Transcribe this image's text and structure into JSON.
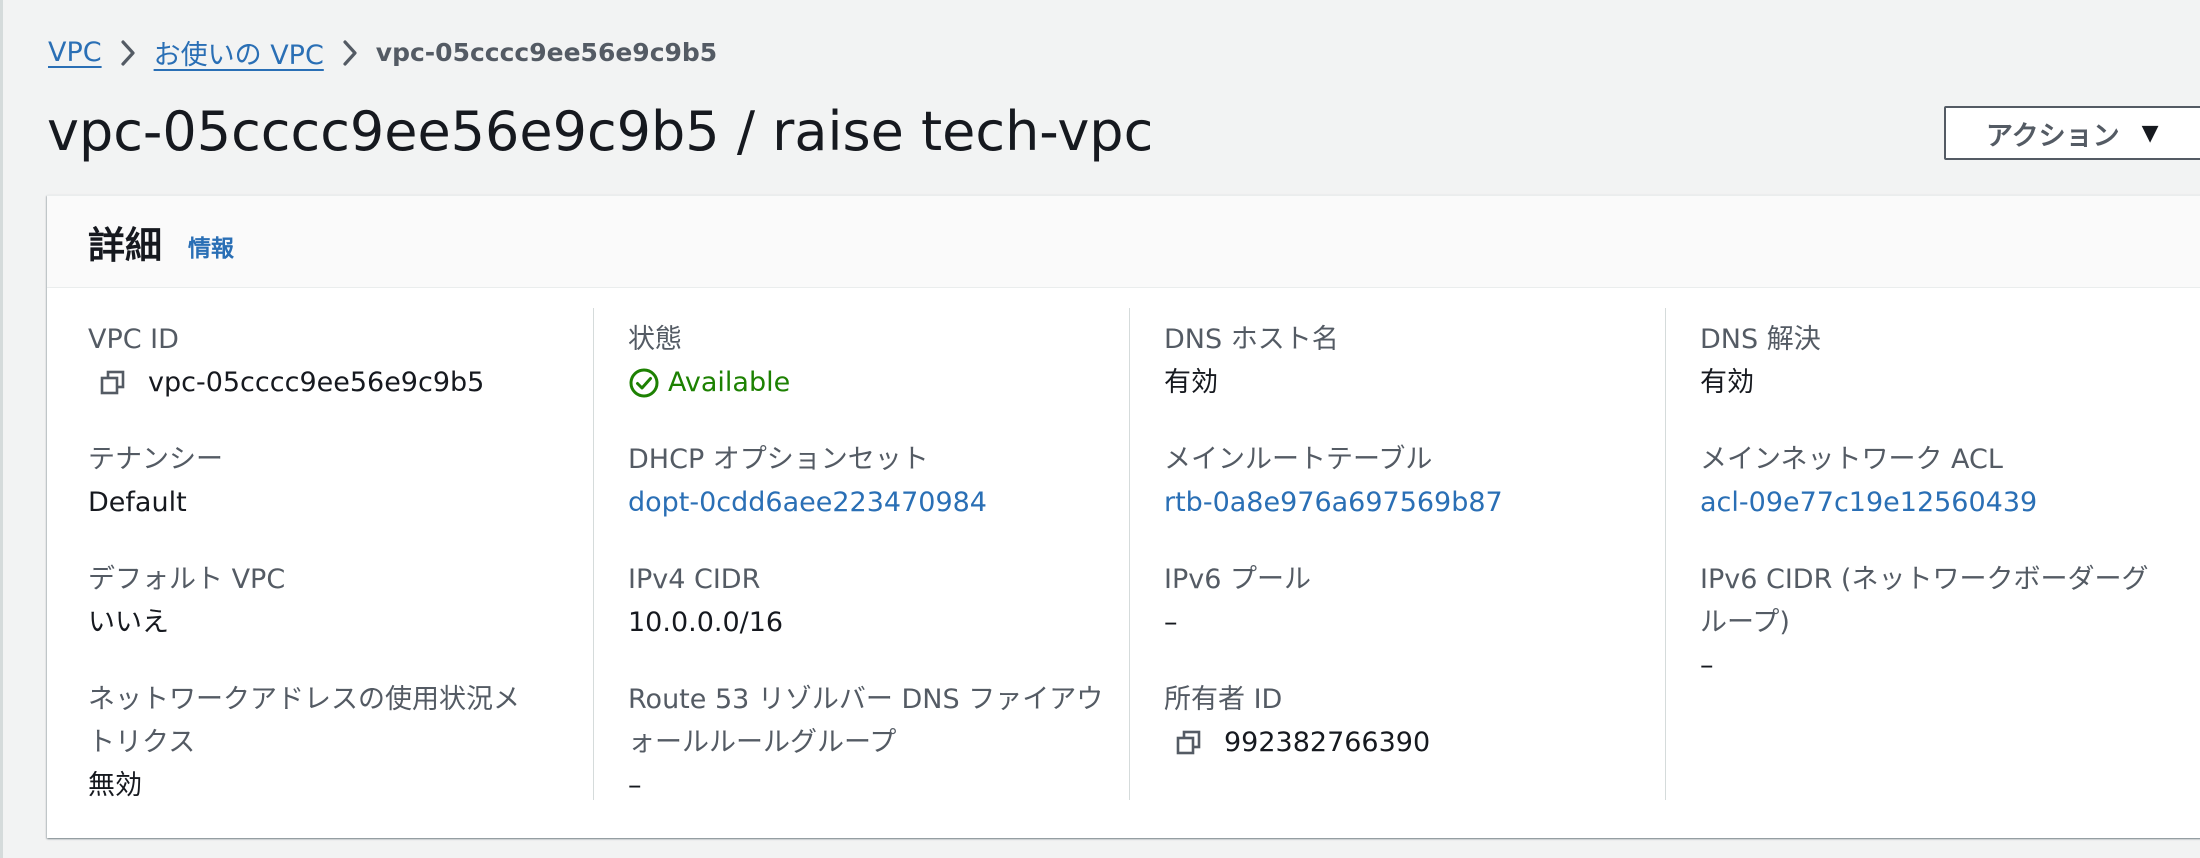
{
  "breadcrumb": {
    "items": [
      {
        "label": "VPC"
      },
      {
        "label": "お使いの VPC"
      }
    ],
    "current": "vpc-05cccc9ee56e9c9b5"
  },
  "page": {
    "title": "vpc-05cccc9ee56e9c9b5 / raise tech-vpc",
    "actions_label": "アクション"
  },
  "details": {
    "title": "詳細",
    "info_label": "情報",
    "columns": [
      [
        {
          "label": "VPC ID",
          "value": "vpc-05cccc9ee56e9c9b5",
          "type": "copy"
        },
        {
          "label": "テナンシー",
          "value": "Default",
          "type": "text"
        },
        {
          "label": "デフォルト VPC",
          "value": "いいえ",
          "type": "text"
        },
        {
          "label_lines": [
            "ネットワークアドレスの使用状況メ",
            "トリクス"
          ],
          "value": "無効",
          "type": "text"
        }
      ],
      [
        {
          "label": "状態",
          "value": "Available",
          "type": "status"
        },
        {
          "label": "DHCP オプションセット",
          "value": "dopt-0cdd6aee223470984",
          "type": "link"
        },
        {
          "label": "IPv4 CIDR",
          "value": "10.0.0.0/16",
          "type": "text"
        },
        {
          "label_lines": [
            "Route 53 リゾルバー DNS ファイアウ",
            "ォールルールグループ"
          ],
          "value": "–",
          "type": "text"
        }
      ],
      [
        {
          "label": "DNS ホスト名",
          "value": "有効",
          "type": "text"
        },
        {
          "label": "メインルートテーブル",
          "value": "rtb-0a8e976a697569b87",
          "type": "link"
        },
        {
          "label": "IPv6 プール",
          "value": "–",
          "type": "text"
        },
        {
          "label": "所有者 ID",
          "value": "992382766390",
          "type": "copy"
        }
      ],
      [
        {
          "label": "DNS 解決",
          "value": "有効",
          "type": "text"
        },
        {
          "label": "メインネットワーク ACL",
          "value": "acl-09e77c19e12560439",
          "type": "link"
        },
        {
          "label_lines": [
            "IPv6 CIDR (ネットワークボーダーグ",
            "ループ)"
          ],
          "value": "–",
          "type": "text"
        }
      ]
    ]
  },
  "colors": {
    "link": "#2a6fb5",
    "status_ok": "#1d8102",
    "label": "#545b64",
    "text": "#16191f",
    "background": "#f2f3f3"
  },
  "icons": {
    "breadcrumb_separator": "chevron-right-icon",
    "status": "check-circle-icon",
    "copy": "copy-icon",
    "dropdown": "caret-down-icon"
  }
}
